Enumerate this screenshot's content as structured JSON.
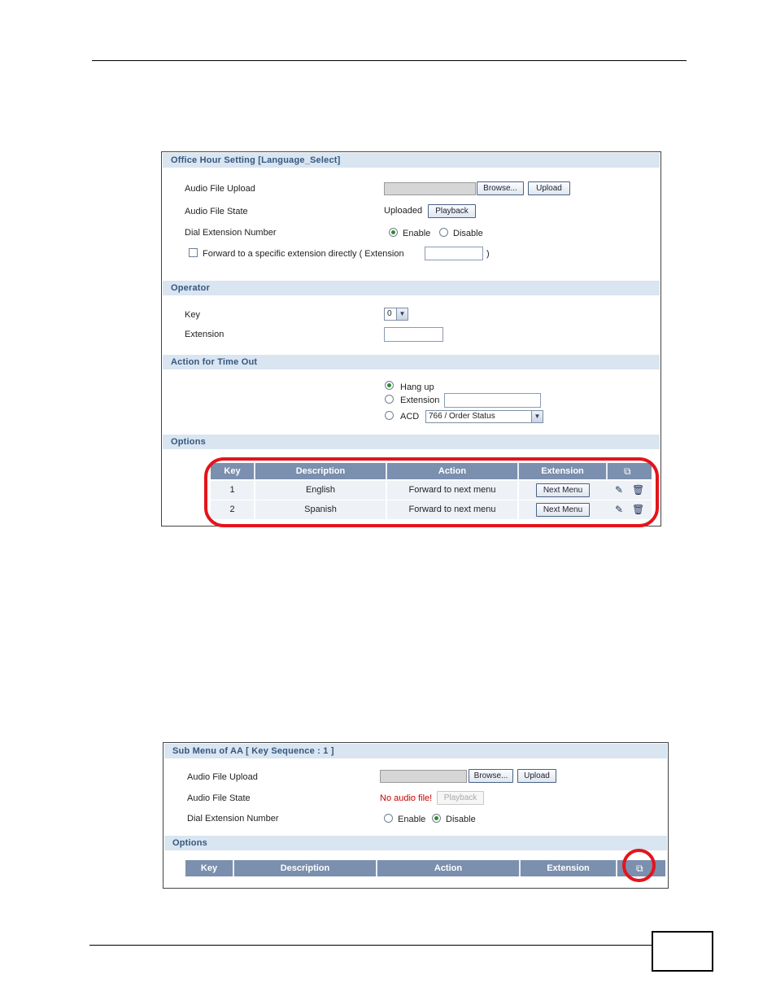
{
  "office": {
    "title": "Office Hour Setting [Language_Select]",
    "audio_upload_label": "Audio File Upload",
    "browse_label": "Browse...",
    "upload_label": "Upload",
    "audio_state_label": "Audio File State",
    "audio_state_value": "Uploaded",
    "playback_label": "Playback",
    "dial_ext_label": "Dial Extension Number",
    "enable_label": "Enable",
    "disable_label": "Disable",
    "forward_label": "Forward to a specific extension directly ( Extension",
    "forward_close": ")",
    "operator_section": "Operator",
    "key_label": "Key",
    "key_value": "0",
    "extension_label": "Extension",
    "timeout_section": "Action for Time Out",
    "hangup_label": "Hang up",
    "timeout_extension_label": "Extension",
    "acd_label": "ACD",
    "acd_value": "766 / Order Status",
    "options_section": "Options",
    "table": {
      "headers": [
        "Key",
        "Description",
        "Action",
        "Extension"
      ],
      "rows": [
        {
          "key": "1",
          "description": "English",
          "action": "Forward to next menu",
          "extension_button": "Next Menu"
        },
        {
          "key": "2",
          "description": "Spanish",
          "action": "Forward to next menu",
          "extension_button": "Next Menu"
        }
      ]
    }
  },
  "submenu": {
    "title": "Sub Menu of AA [ Key Sequence : 1 ]",
    "audio_upload_label": "Audio File Upload",
    "browse_label": "Browse...",
    "upload_label": "Upload",
    "audio_state_label": "Audio File State",
    "audio_state_value": "No audio file!",
    "playback_label": "Playback",
    "dial_ext_label": "Dial Extension Number",
    "enable_label": "Enable",
    "disable_label": "Disable",
    "options_section": "Options",
    "table": {
      "headers": [
        "Key",
        "Description",
        "Action",
        "Extension"
      ]
    }
  },
  "colors": {
    "section_bg": "#d9e5f1",
    "section_text": "#35577e",
    "table_header": "#7b8fae",
    "highlight": "#e4141c"
  }
}
